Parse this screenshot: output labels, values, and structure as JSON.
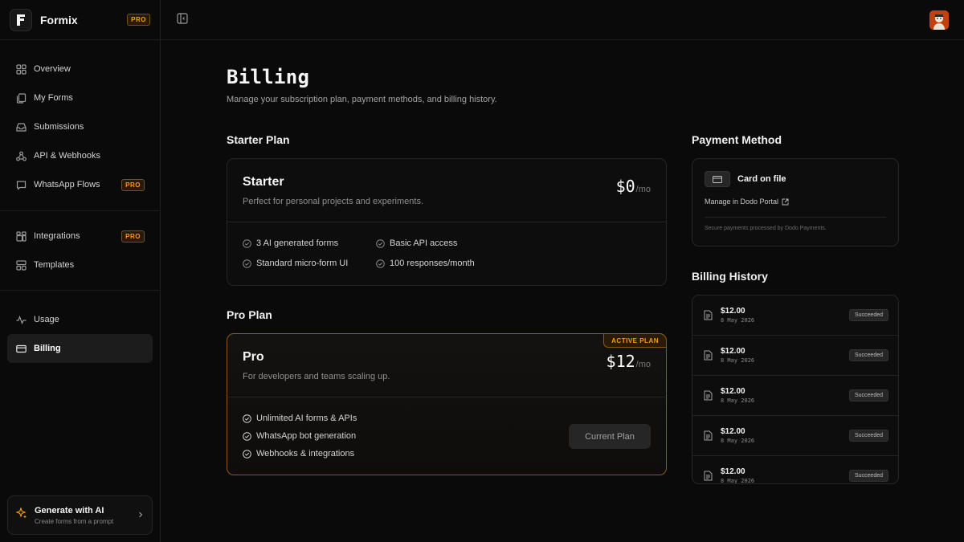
{
  "brand": {
    "name": "Formix",
    "badge": "PRO"
  },
  "sidebar": {
    "items": [
      {
        "label": "Overview",
        "icon": "grid-icon"
      },
      {
        "label": "My Forms",
        "icon": "file-icon"
      },
      {
        "label": "Submissions",
        "icon": "inbox-icon"
      },
      {
        "label": "API & Webhooks",
        "icon": "webhook-icon"
      },
      {
        "label": "WhatsApp Flows",
        "icon": "message-icon",
        "badge": "PRO"
      },
      {
        "label": "Integrations",
        "icon": "blocks-icon",
        "badge": "PRO"
      },
      {
        "label": "Templates",
        "icon": "layout-icon"
      },
      {
        "label": "Usage",
        "icon": "activity-icon"
      },
      {
        "label": "Billing",
        "icon": "credit-card-icon",
        "active": true
      }
    ],
    "generate": {
      "title": "Generate with AI",
      "subtitle": "Create forms from a prompt"
    }
  },
  "page": {
    "title": "Billing",
    "subtitle": "Manage your subscription plan, payment methods, and billing history."
  },
  "starter": {
    "section_title": "Starter Plan",
    "name": "Starter",
    "description": "Perfect for personal projects and experiments.",
    "price": "$0",
    "period": "/mo",
    "features": [
      "3 AI generated forms",
      "Basic API access",
      "Standard micro-form UI",
      "100 responses/month"
    ]
  },
  "pro": {
    "section_title": "Pro Plan",
    "name": "Pro",
    "description": "For developers and teams scaling up.",
    "price": "$12",
    "period": "/mo",
    "tag": "ACTIVE PLAN",
    "features": [
      "Unlimited AI forms & APIs",
      "WhatsApp bot generation",
      "Webhooks & integrations"
    ],
    "button": "Current Plan"
  },
  "payment": {
    "section_title": "Payment Method",
    "card_label": "Card on file",
    "manage_link": "Manage in Dodo Portal",
    "note": "Secure payments processed by Dodo Payments."
  },
  "history": {
    "section_title": "Billing History",
    "rows": [
      {
        "amount": "$12.00",
        "date": "8 May 2026",
        "status": "Succeeded"
      },
      {
        "amount": "$12.00",
        "date": "8 May 2026",
        "status": "Succeeded"
      },
      {
        "amount": "$12.00",
        "date": "8 May 2026",
        "status": "Succeeded"
      },
      {
        "amount": "$12.00",
        "date": "8 May 2026",
        "status": "Succeeded"
      },
      {
        "amount": "$12.00",
        "date": "8 May 2026",
        "status": "Succeeded"
      }
    ]
  },
  "colors": {
    "accent": "#f59e0b",
    "background": "#0a0a0a",
    "border": "#262626"
  }
}
